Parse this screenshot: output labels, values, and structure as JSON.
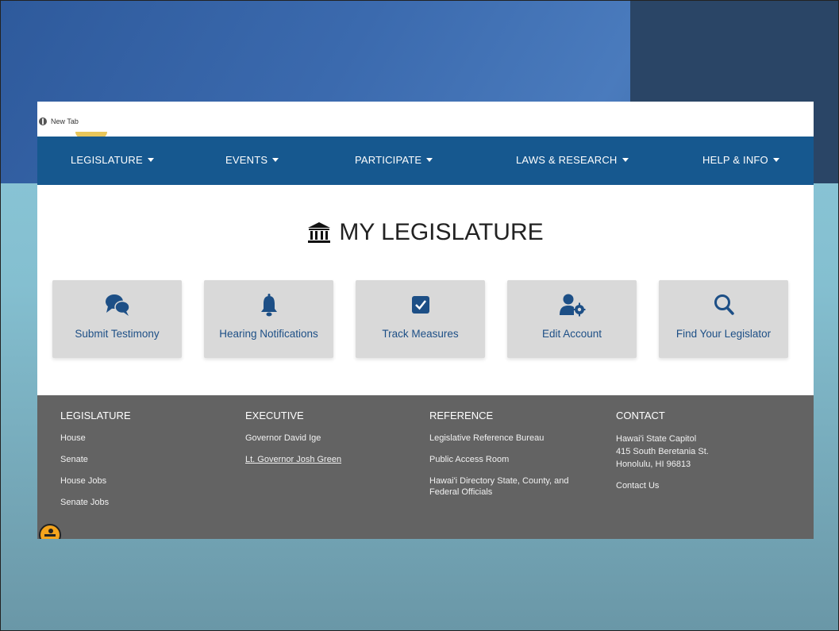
{
  "browser": {
    "tab_label": "New Tab"
  },
  "nav": {
    "items": [
      {
        "label": "LEGISLATURE"
      },
      {
        "label": "EVENTS"
      },
      {
        "label": "PARTICIPATE"
      },
      {
        "label": "LAWS & RESEARCH"
      },
      {
        "label": "HELP & INFO"
      }
    ]
  },
  "page": {
    "title": "MY LEGISLATURE",
    "title_icon": "capitol-building-icon"
  },
  "cards": [
    {
      "label": "Submit Testimony",
      "icon": "chat-bubbles-icon"
    },
    {
      "label": "Hearing Notifications",
      "icon": "bell-icon"
    },
    {
      "label": "Track Measures",
      "icon": "checkbox-icon"
    },
    {
      "label": "Edit Account",
      "icon": "user-gear-icon"
    },
    {
      "label": "Find Your Legislator",
      "icon": "search-icon"
    }
  ],
  "footer": {
    "legislature": {
      "heading": "LEGISLATURE",
      "links": [
        "House",
        "Senate",
        "House Jobs",
        "Senate Jobs"
      ]
    },
    "executive": {
      "heading": "EXECUTIVE",
      "links": [
        "Governor David Ige",
        "Lt. Governor Josh Green"
      ]
    },
    "reference": {
      "heading": "REFERENCE",
      "links": [
        "Legislative Reference Bureau",
        "Public Access Room",
        "Hawai'i Directory State, County, and Federal Officials"
      ]
    },
    "contact": {
      "heading": "CONTACT",
      "address": [
        "Hawai'i State Capitol",
        "415 South Beretania St.",
        "Honolulu, HI 96813"
      ],
      "link": "Contact Us"
    }
  },
  "colors": {
    "nav_bg": "#16588f",
    "card_bg": "#d9d9d9",
    "card_text": "#1d4f86",
    "footer_bg": "#636363"
  }
}
